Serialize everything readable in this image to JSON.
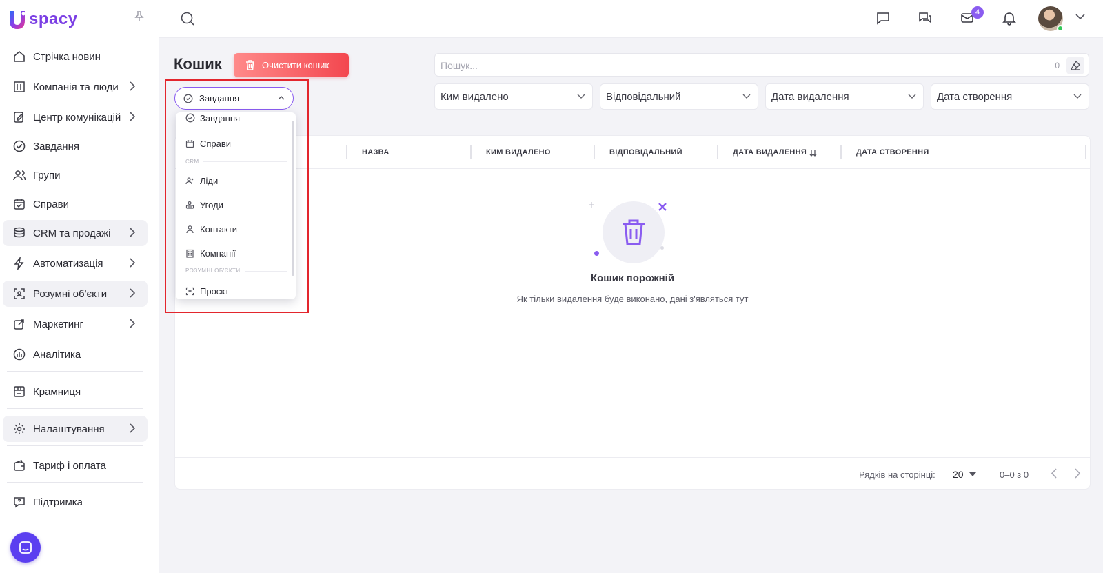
{
  "logo": {
    "text": "spacy"
  },
  "sidebar": {
    "items": [
      {
        "label": "Стрічка новин",
        "icon": "home-icon"
      },
      {
        "label": "Компанія та люди",
        "icon": "company-icon"
      },
      {
        "label": "Центр комунікацій",
        "icon": "communication-icon"
      },
      {
        "label": "Завдання",
        "icon": "check-circle-icon"
      },
      {
        "label": "Групи",
        "icon": "group-icon"
      },
      {
        "label": "Справи",
        "icon": "calendar-icon"
      },
      {
        "label": "CRM та продажі",
        "icon": "crm-icon"
      },
      {
        "label": "Автоматизація",
        "icon": "lightning-icon"
      },
      {
        "label": "Розумні об'єкти",
        "icon": "smart-object-icon"
      },
      {
        "label": "Маркетинг",
        "icon": "marketing-icon"
      },
      {
        "label": "Аналітика",
        "icon": "analytics-icon"
      },
      {
        "label": "Крамниця",
        "icon": "store-icon"
      },
      {
        "label": "Налаштування",
        "icon": "settings-icon"
      },
      {
        "label": "Тариф і оплата",
        "icon": "wallet-icon"
      },
      {
        "label": "Підтримка",
        "icon": "support-icon"
      }
    ]
  },
  "topbar": {
    "mail_badge": "4"
  },
  "page": {
    "title": "Кошик",
    "clear_button": "Очистити кошик"
  },
  "search": {
    "placeholder": "Пошук...",
    "count": "0"
  },
  "filters": [
    "Ким видалено",
    "Відповідальний",
    "Дата видалення",
    "Дата створення"
  ],
  "type_select": {
    "value": "Завдання"
  },
  "dropdown": {
    "items": [
      "Завдання",
      "Справи"
    ],
    "crm_group": "CRM",
    "crm_items": [
      "Ліди",
      "Угоди",
      "Контакти",
      "Компанії"
    ],
    "smart_group": "РОЗУМНІ ОБ'ЄКТИ",
    "smart_items": [
      "Проєкт"
    ]
  },
  "table": {
    "columns": [
      "НАЗВА",
      "КИМ ВИДАЛЕНО",
      "ВІДПОВІДАЛЬНИЙ",
      "ДАТА ВИДАЛЕННЯ",
      "ДАТА СТВОРЕННЯ"
    ],
    "empty_title": "Кошик порожній",
    "empty_subtitle": "Як тільки видалення буде виконано, дані з'являться тут",
    "rows_per_page_label": "Рядків на сторінці:",
    "rows_per_page": "20",
    "range": "0–0 з 0"
  },
  "colors": {
    "accent": "#8a5cf0",
    "danger": "#f3474f",
    "highlight": "#e3262d"
  }
}
